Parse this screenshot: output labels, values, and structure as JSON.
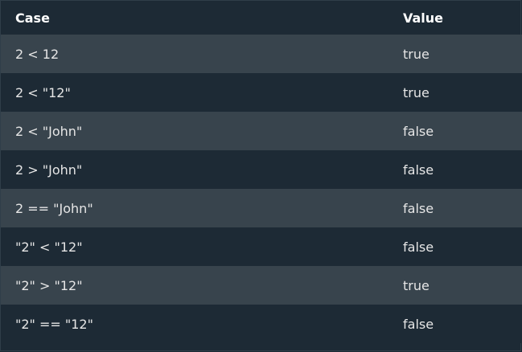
{
  "table": {
    "headers": {
      "case": "Case",
      "value": "Value"
    },
    "rows": [
      {
        "case": "2 < 12",
        "value": "true"
      },
      {
        "case": "2 < \"12\"",
        "value": "true"
      },
      {
        "case": "2 < \"John\"",
        "value": "false"
      },
      {
        "case": "2 > \"John\"",
        "value": "false"
      },
      {
        "case": "2 == \"John\"",
        "value": "false"
      },
      {
        "case": "\"2\" < \"12\"",
        "value": "false"
      },
      {
        "case": "\"2\" > \"12\"",
        "value": "true"
      },
      {
        "case": "\"2\" == \"12\"",
        "value": "false"
      }
    ]
  },
  "colors": {
    "background": "#1d2a35",
    "row_alt": "#38444d",
    "border": "#2f3e49",
    "text": "#e6e6e6"
  }
}
